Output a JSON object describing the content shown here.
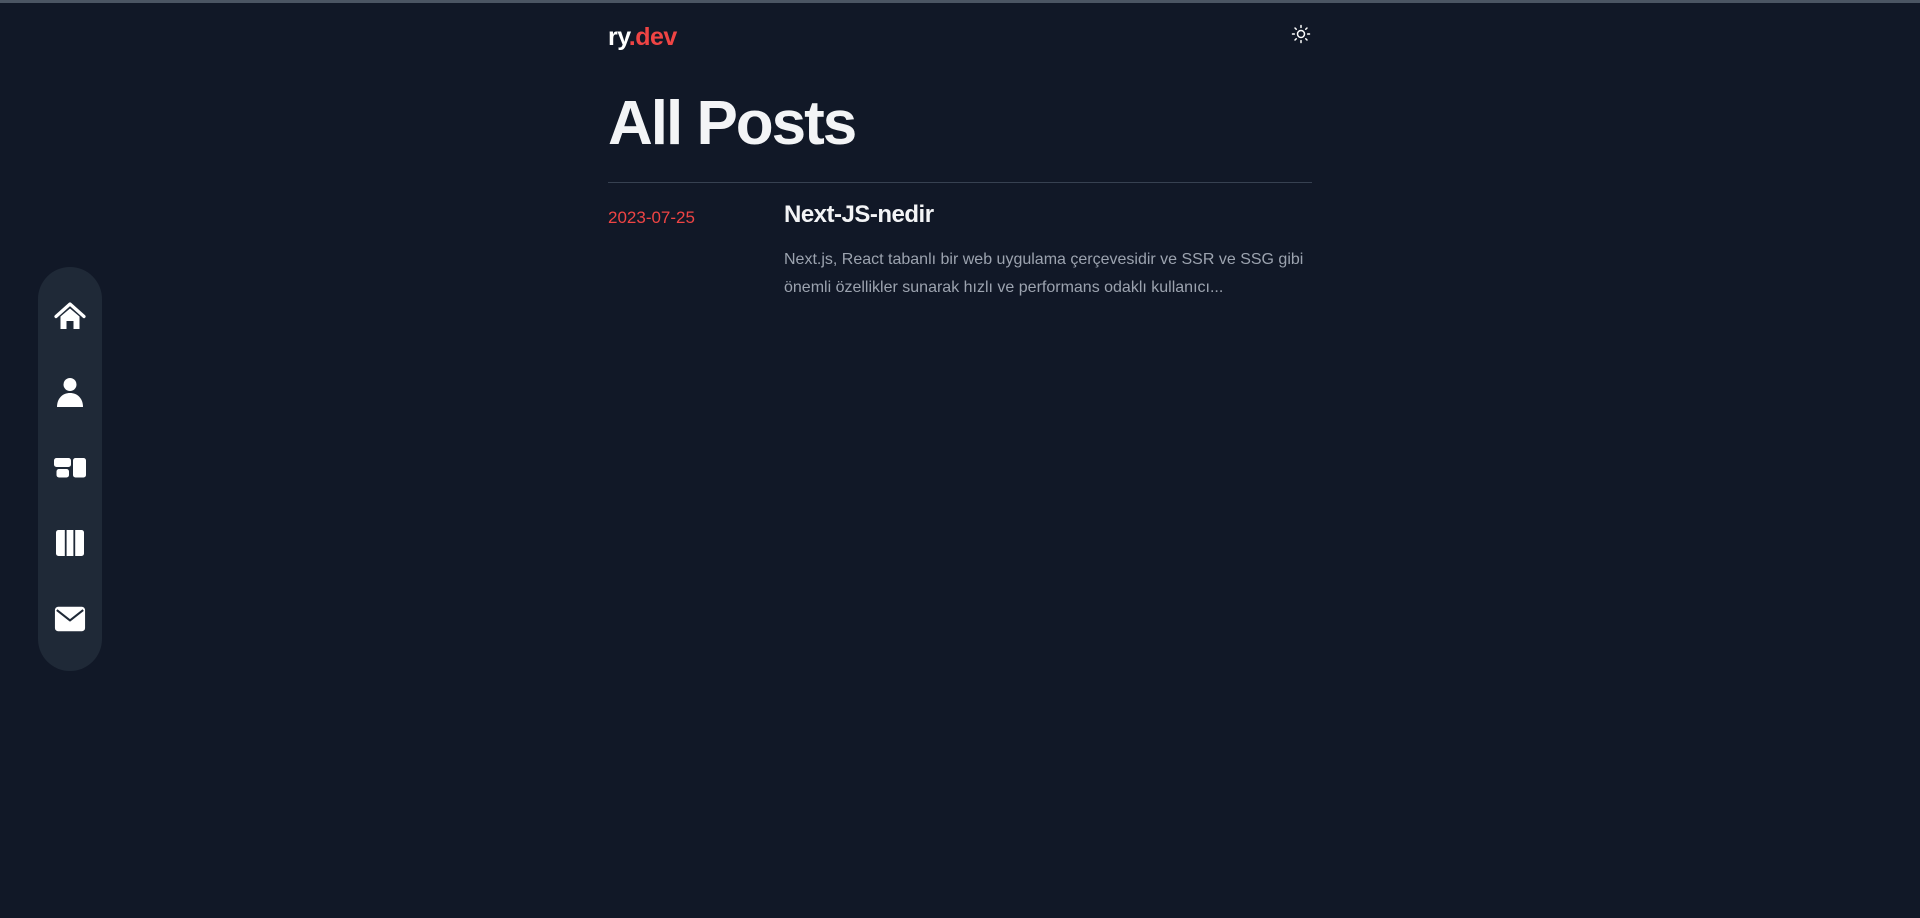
{
  "site": {
    "logo_prefix": "ry",
    "logo_dot": ".",
    "logo_suffix": "dev"
  },
  "header": {
    "theme_toggle_icon": "sun-icon"
  },
  "page": {
    "title": "All Posts"
  },
  "posts": [
    {
      "date": "2023-07-25",
      "title": "Next-JS-nedir",
      "excerpt": "Next.js, React tabanlı bir web uygulama çerçevesidir ve SSR ve SSG gibi önemli özellikler sunarak hızlı ve performans odaklı kullanıcı..."
    }
  ],
  "dock": {
    "items": [
      {
        "icon": "home-icon"
      },
      {
        "icon": "user-icon"
      },
      {
        "icon": "projects-icon"
      },
      {
        "icon": "library-icon"
      },
      {
        "icon": "mail-icon"
      }
    ]
  },
  "colors": {
    "background": "#111827",
    "accent": "#ef4444",
    "dock_background": "#1f2937",
    "excerpt_text": "#9ca3af"
  }
}
